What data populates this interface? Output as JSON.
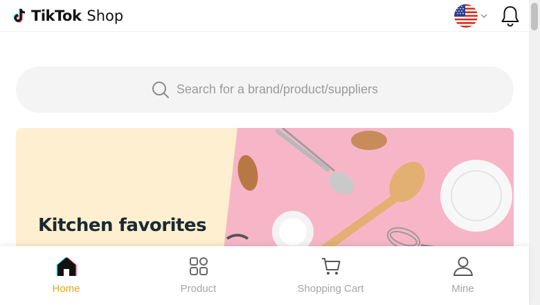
{
  "header": {
    "logo_wordmark": "TikTok",
    "logo_suffix": "Shop",
    "language_flag": "us-flag",
    "notification_icon": "bell-icon"
  },
  "search": {
    "placeholder": "Search for a brand/product/suppliers",
    "icon": "search-icon"
  },
  "banner": {
    "title": "Kitchen favorites",
    "background_color": "#fdefcf",
    "photo_color": "#f7b6c8"
  },
  "bottom_nav": {
    "active_color": "#e8a317",
    "items": [
      {
        "label": "Home",
        "icon": "home-icon",
        "active": true
      },
      {
        "label": "Product",
        "icon": "grid-icon",
        "active": false
      },
      {
        "label": "Shopping Cart",
        "icon": "cart-icon",
        "active": false
      },
      {
        "label": "Mine",
        "icon": "user-icon",
        "active": false
      }
    ]
  }
}
